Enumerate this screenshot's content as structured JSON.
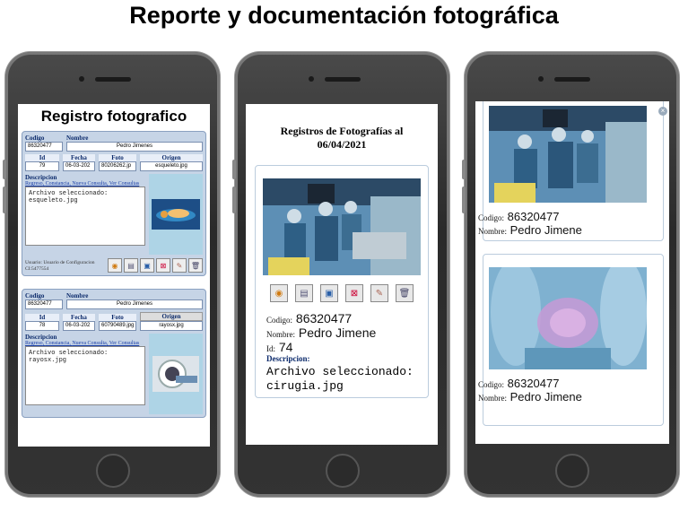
{
  "title": "Reporte y documentación fotográfica",
  "phone1": {
    "title": "Registro fotografico",
    "labels": {
      "codigo": "Codigo",
      "nombre": "Nombre",
      "id": "Id",
      "fecha": "Fecha",
      "foto": "Foto",
      "origen": "Origen",
      "descripcion": "Descripcion"
    },
    "links": {
      "regresar": "Regreso",
      "constancia": "Constancia",
      "nueva": "Nueva Consulta",
      "ver": "Ver Consultas"
    },
    "records": [
      {
        "codigo": "86320477",
        "nombre": "Pedro Jimenes",
        "id": "79",
        "fecha": "06-03-202",
        "foto": "80206262.jp",
        "origen": "esqueleto.jpg",
        "descripcion": "Archivo seleccionado: esqueleto.jpg",
        "usuario": "Usuario: Usuario de Configuracion CI:5477554"
      },
      {
        "codigo": "86320477",
        "nombre": "Pedro Jimenes",
        "id": "78",
        "fecha": "06-03-202",
        "foto": "60790489.jpg",
        "origen": "rayosx.jpg",
        "descripcion": "Archivo seleccionado: rayosx.jpg",
        "usuario": ""
      }
    ]
  },
  "phone2": {
    "title": "Registros de Fotografías al 06/04/2021",
    "labels": {
      "codigo": "Codigo:",
      "nombre": "Nombre:",
      "id": "Id:",
      "descripcion": "Descripcion:"
    },
    "codigo": "86320477",
    "nombre": "Pedro Jimene",
    "id": "74",
    "descripcion": "Archivo seleccionado: cirugia.jpg"
  },
  "phone3": {
    "labels": {
      "codigo": "Codigo:",
      "nombre": "Nombre:"
    },
    "cards": [
      {
        "codigo": "86320477",
        "nombre": "Pedro Jimene"
      },
      {
        "codigo": "86320477",
        "nombre": "Pedro Jimene"
      }
    ]
  }
}
